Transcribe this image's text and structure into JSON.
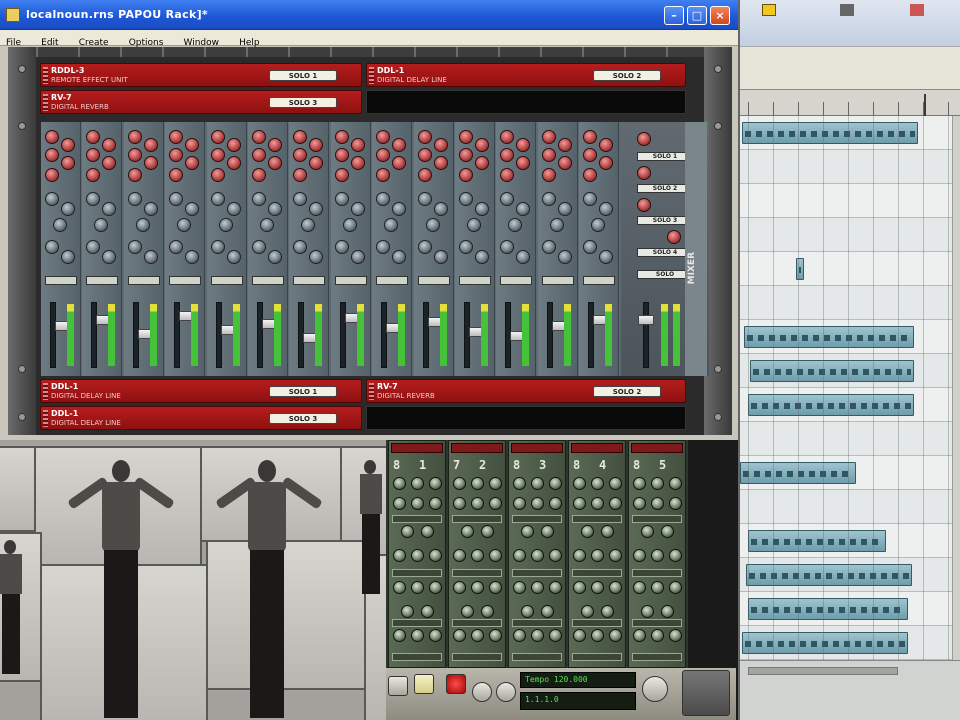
{
  "window": {
    "title": "localnoun.rns PAPOU Rack]*",
    "buttons": {
      "minimize": "–",
      "maximize": "□",
      "close": "×"
    }
  },
  "menu": [
    "File",
    "Edit",
    "Create",
    "Options",
    "Window",
    "Help"
  ],
  "rack": {
    "top_devices": [
      {
        "name": "RDDL-3",
        "sub": "REMOTE EFFECT UNIT",
        "button": "SOLO 1"
      },
      {
        "name": "DDL-1",
        "sub": "DIGITAL DELAY LINE",
        "button": "SOLO 2"
      },
      {
        "name": "RV-7",
        "sub": "DIGITAL REVERB",
        "button": "SOLO 3"
      }
    ],
    "bottom_devices": [
      {
        "name": "DDL-1",
        "sub": "DIGITAL DELAY LINE",
        "button": "SOLO 1"
      },
      {
        "name": "RV-7",
        "sub": "DIGITAL REVERB",
        "button": "SOLO 2"
      },
      {
        "name": "DDL-1",
        "sub": "DIGITAL DELAY LINE",
        "button": "SOLO 3"
      }
    ],
    "mixer": {
      "side_label": "MIXER",
      "master_buttons": [
        "SOLO 1",
        "SOLO 2",
        "SOLO 3",
        "SOLO 4",
        "SOLO"
      ],
      "channel_count": 14
    }
  },
  "synths": [
    {
      "n1": "8",
      "n2": "1"
    },
    {
      "n1": "7",
      "n2": "2"
    },
    {
      "n1": "8",
      "n2": "3"
    },
    {
      "n1": "8",
      "n2": "4"
    },
    {
      "n1": "8",
      "n2": "5"
    }
  ],
  "transport": {
    "lcd_top": "Tempo 120.000",
    "lcd_bottom": "1.1.1.0"
  },
  "colors": {
    "titlebar": "#1d56d6",
    "device_red": "#8f1010",
    "clip": "#6f9dac",
    "meter_green": "#45c23a"
  }
}
